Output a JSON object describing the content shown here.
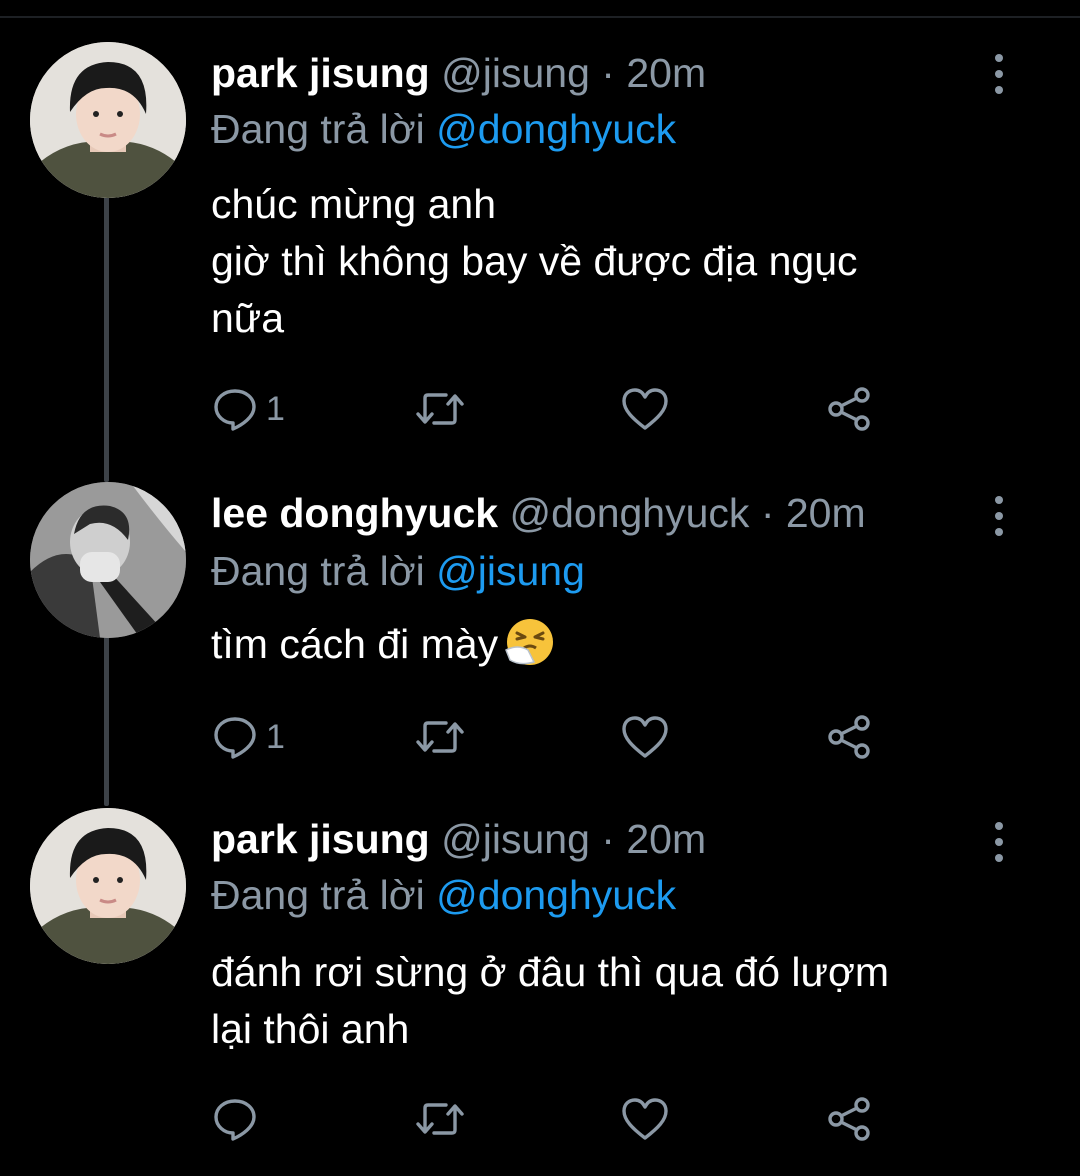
{
  "tweets": [
    {
      "name": "park jisung",
      "handle": "@jisung",
      "separator": "·",
      "time": "20m",
      "replying_prefix": "Đang trả lời",
      "replying_to": "@donghyuck",
      "lines": [
        "chúc mừng anh",
        "giờ thì không bay về được địa ngục",
        "nữa"
      ],
      "reply_count": "1",
      "avatar": "photo-boy-hoodie"
    },
    {
      "name": "lee donghyuck",
      "handle": "@donghyuck",
      "separator": "·",
      "time": "20m",
      "replying_prefix": "Đang trả lời",
      "replying_to": "@jisung",
      "lines": [
        "tìm cách đi mày"
      ],
      "emoji": "sneezing-face",
      "reply_count": "1",
      "avatar": "photo-grayscale"
    },
    {
      "name": "park jisung",
      "handle": "@jisung",
      "separator": "·",
      "time": "20m",
      "replying_prefix": "Đang trả lời",
      "replying_to": "@donghyuck",
      "lines": [
        "đánh rơi sừng ở đâu thì qua đó lượm",
        "lại thôi anh"
      ],
      "reply_count": "",
      "avatar": "photo-boy-hoodie"
    }
  ],
  "icons": {
    "reply": "reply-icon",
    "retweet": "retweet-icon",
    "like": "heart-icon",
    "share": "share-icon",
    "more": "more-vertical-icon"
  },
  "colors": {
    "background": "#000000",
    "text": "#ffffff",
    "secondary": "#8b98a5",
    "mention": "#1d9bf0",
    "thread_line": "#3d4248"
  }
}
